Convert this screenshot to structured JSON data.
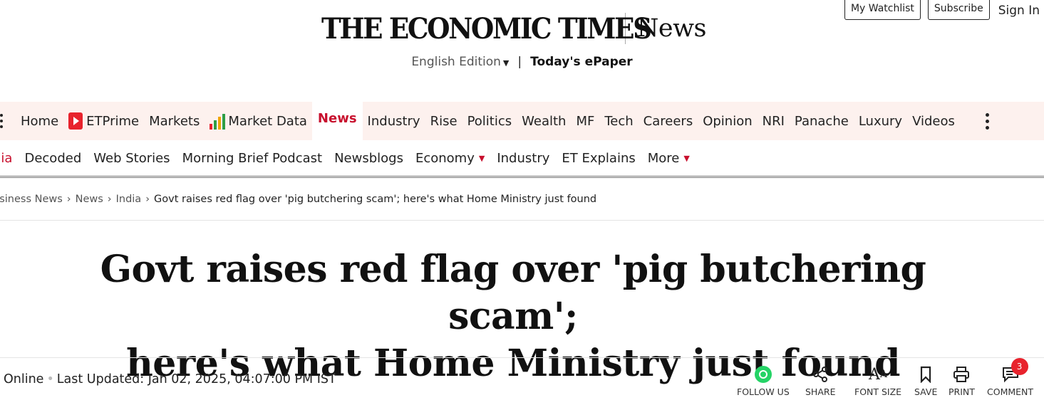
{
  "account": {
    "watchlist": "My Watchlist",
    "subscribe": "Subscribe",
    "signin": "Sign In"
  },
  "masthead": {
    "logo_text": "THE ECONOMIC TIMES",
    "section": "News",
    "edition": "English Edition",
    "separator": "|",
    "epaper": "Today's ePaper"
  },
  "nav_main": {
    "items": [
      {
        "label": "Home"
      },
      {
        "label": "ETPrime",
        "icon": "etprime-icon"
      },
      {
        "label": "Markets"
      },
      {
        "label": "Market Data",
        "icon": "market-data-icon"
      },
      {
        "label": "News",
        "active": true
      },
      {
        "label": "Industry"
      },
      {
        "label": "Rise"
      },
      {
        "label": "Politics"
      },
      {
        "label": "Wealth"
      },
      {
        "label": "MF"
      },
      {
        "label": "Tech"
      },
      {
        "label": "Careers"
      },
      {
        "label": "Opinion"
      },
      {
        "label": "NRI"
      },
      {
        "label": "Panache"
      },
      {
        "label": "Luxury"
      },
      {
        "label": "Videos"
      }
    ]
  },
  "nav_sub": {
    "items": [
      {
        "label": "dia",
        "current": true
      },
      {
        "label": "Decoded"
      },
      {
        "label": "Web Stories"
      },
      {
        "label": "Morning Brief Podcast"
      },
      {
        "label": "Newsblogs"
      },
      {
        "label": "Economy",
        "dropdown": true
      },
      {
        "label": "Industry"
      },
      {
        "label": "ET Explains"
      },
      {
        "label": "More",
        "dropdown": true
      }
    ]
  },
  "breadcrumb": {
    "items": [
      "usiness News",
      "News",
      "India"
    ],
    "separator": "›",
    "current": "Govt raises red flag over 'pig butchering scam'; here's what Home Ministry just found"
  },
  "article": {
    "headline_line1": "Govt raises red flag over 'pig butchering scam';",
    "headline_line2": "here's what Home Ministry just found",
    "byline_source": "Online",
    "byline_updated": "Last Updated: Jan 02, 2025, 04:07:00 PM IST"
  },
  "tools": {
    "follow_us": "FOLLOW US",
    "share": "SHARE",
    "font_size": "FONT SIZE",
    "save": "SAVE",
    "print": "PRINT",
    "comment": "COMMENT",
    "comment_count": "3"
  },
  "colors": {
    "brand_red": "#c8102e",
    "nav_background": "#fdf1ee",
    "whatsapp_green": "#25d366"
  }
}
